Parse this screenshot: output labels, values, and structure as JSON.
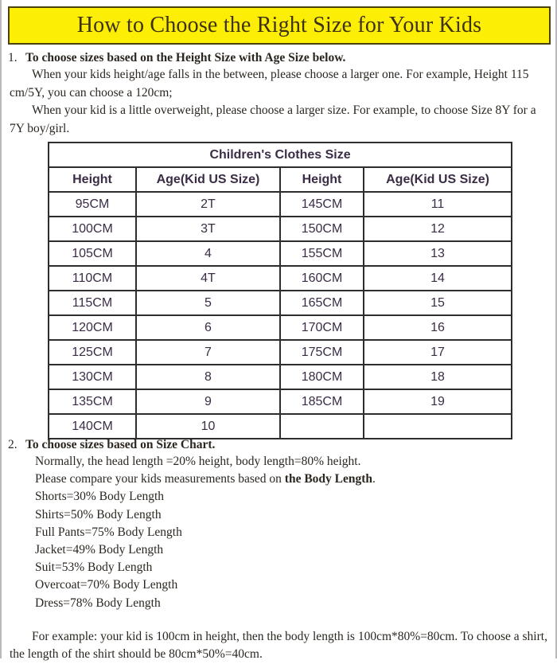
{
  "title": "How to Choose the Right Size for Your Kids",
  "colors": {
    "banner_background": "#fcee04",
    "banner_border": "#4a4207",
    "title_text": "#3d3112",
    "table_title_background": "#fbf8d6",
    "column_header_background": "#e6e6e6",
    "table_border": "#2d2d2d",
    "cell_text": "#3b2c46",
    "page_border": "#b9b9b9"
  },
  "section1": {
    "number": "1.",
    "heading": "To choose sizes based on the Height Size with Age Size below.",
    "paragraphs": [
      "When your kids height/age falls in the between, please choose a larger one. For example, Height 115 cm/5Y, you can choose a 120cm;",
      "When your kid is a little overweight, please choose a larger size. For example, to choose Size 8Y for a 7Y boy/girl."
    ]
  },
  "table": {
    "title": "Children's Clothes Size",
    "columns": [
      "Height",
      "Age(Kid US Size)",
      "Height",
      "Age(Kid US Size)"
    ],
    "rows": [
      [
        "95CM",
        "2T",
        "145CM",
        "11"
      ],
      [
        "100CM",
        "3T",
        "150CM",
        "12"
      ],
      [
        "105CM",
        "4",
        "155CM",
        "13"
      ],
      [
        "110CM",
        "4T",
        "160CM",
        "14"
      ],
      [
        "115CM",
        "5",
        "165CM",
        "15"
      ],
      [
        "120CM",
        "6",
        "170CM",
        "16"
      ],
      [
        "125CM",
        "7",
        "175CM",
        "17"
      ],
      [
        "130CM",
        "8",
        "180CM",
        "18"
      ],
      [
        "135CM",
        "9",
        "185CM",
        "19"
      ],
      [
        "140CM",
        "10",
        "",
        ""
      ]
    ]
  },
  "section2": {
    "number": "2.",
    "heading": "To choose sizes based on Size Chart.",
    "intro_lines": [
      "Normally, the head length =20% height, body length=80% height.",
      "Please compare your kids measurements based on "
    ],
    "intro_bold": "the Body Length",
    "intro_bold_tail": ".",
    "measurements": [
      "Shorts=30% Body Length",
      "Shirts=50% Body Length",
      "Full Pants=75% Body Length",
      "Jacket=49% Body Length",
      "Suit=53% Body Length",
      "Overcoat=70% Body Length",
      "Dress=78% Body Length"
    ],
    "example": "For example: your kid is 100cm in height, then the body length is 100cm*80%=80cm. To choose a shirt, the length of the shirt should be 80cm*50%=40cm."
  }
}
